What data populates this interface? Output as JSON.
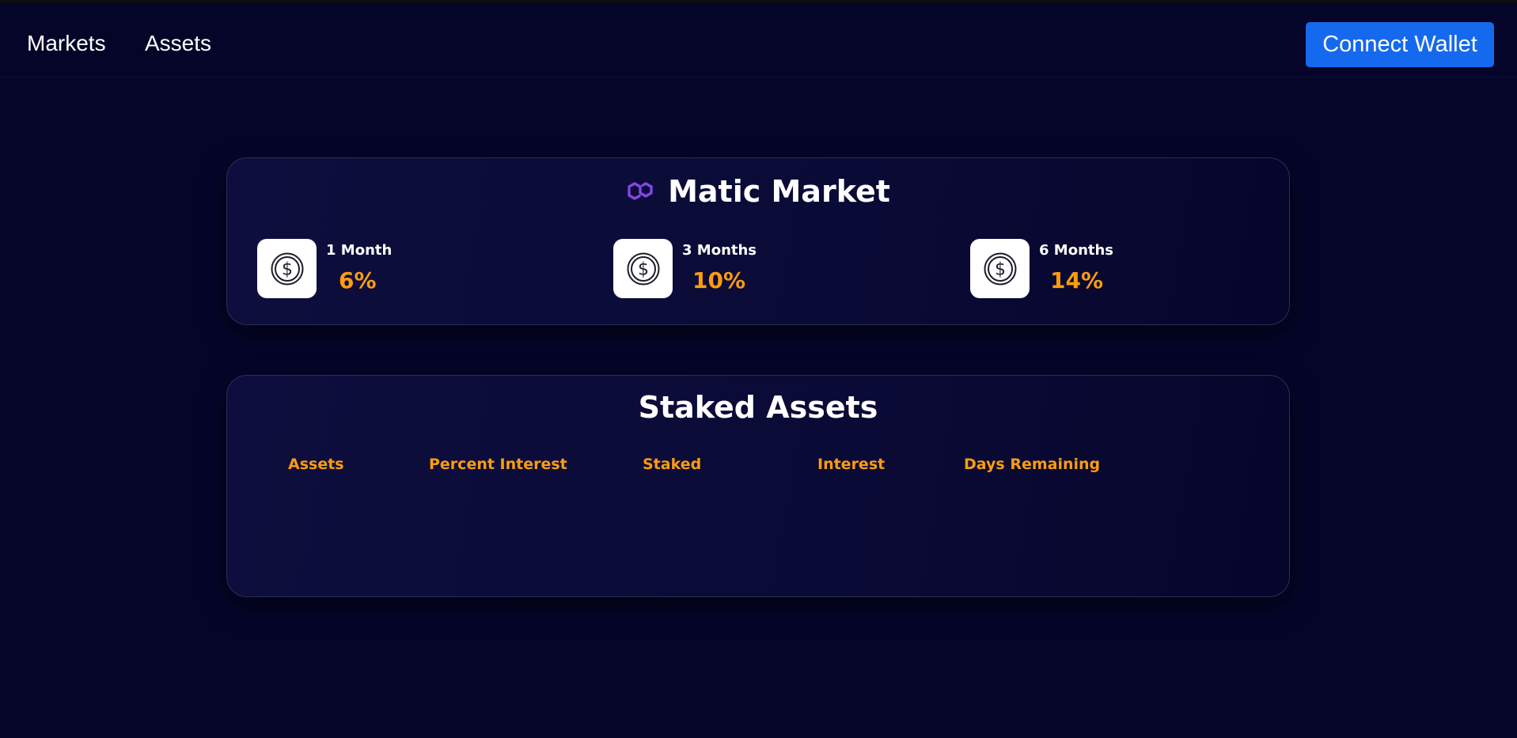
{
  "nav": {
    "links": [
      "Markets",
      "Assets"
    ],
    "connect_label": "Connect Wallet"
  },
  "market": {
    "icon": "polygon-matic-icon",
    "title": "Matic Market",
    "terms": [
      {
        "label": "1 Month",
        "rate": "6%",
        "icon": "dollar-coin-icon"
      },
      {
        "label": "3 Months",
        "rate": "10%",
        "icon": "dollar-coin-icon"
      },
      {
        "label": "6 Months",
        "rate": "14%",
        "icon": "dollar-coin-icon"
      }
    ]
  },
  "staked": {
    "title": "Staked Assets",
    "columns": [
      "Assets",
      "Percent Interest",
      "Staked",
      "Interest",
      "Days Remaining"
    ],
    "rows": []
  },
  "colors": {
    "background": "#05052a",
    "accent": "#ff9c0e",
    "button": "#1569ee",
    "matic": "#8247e5"
  }
}
